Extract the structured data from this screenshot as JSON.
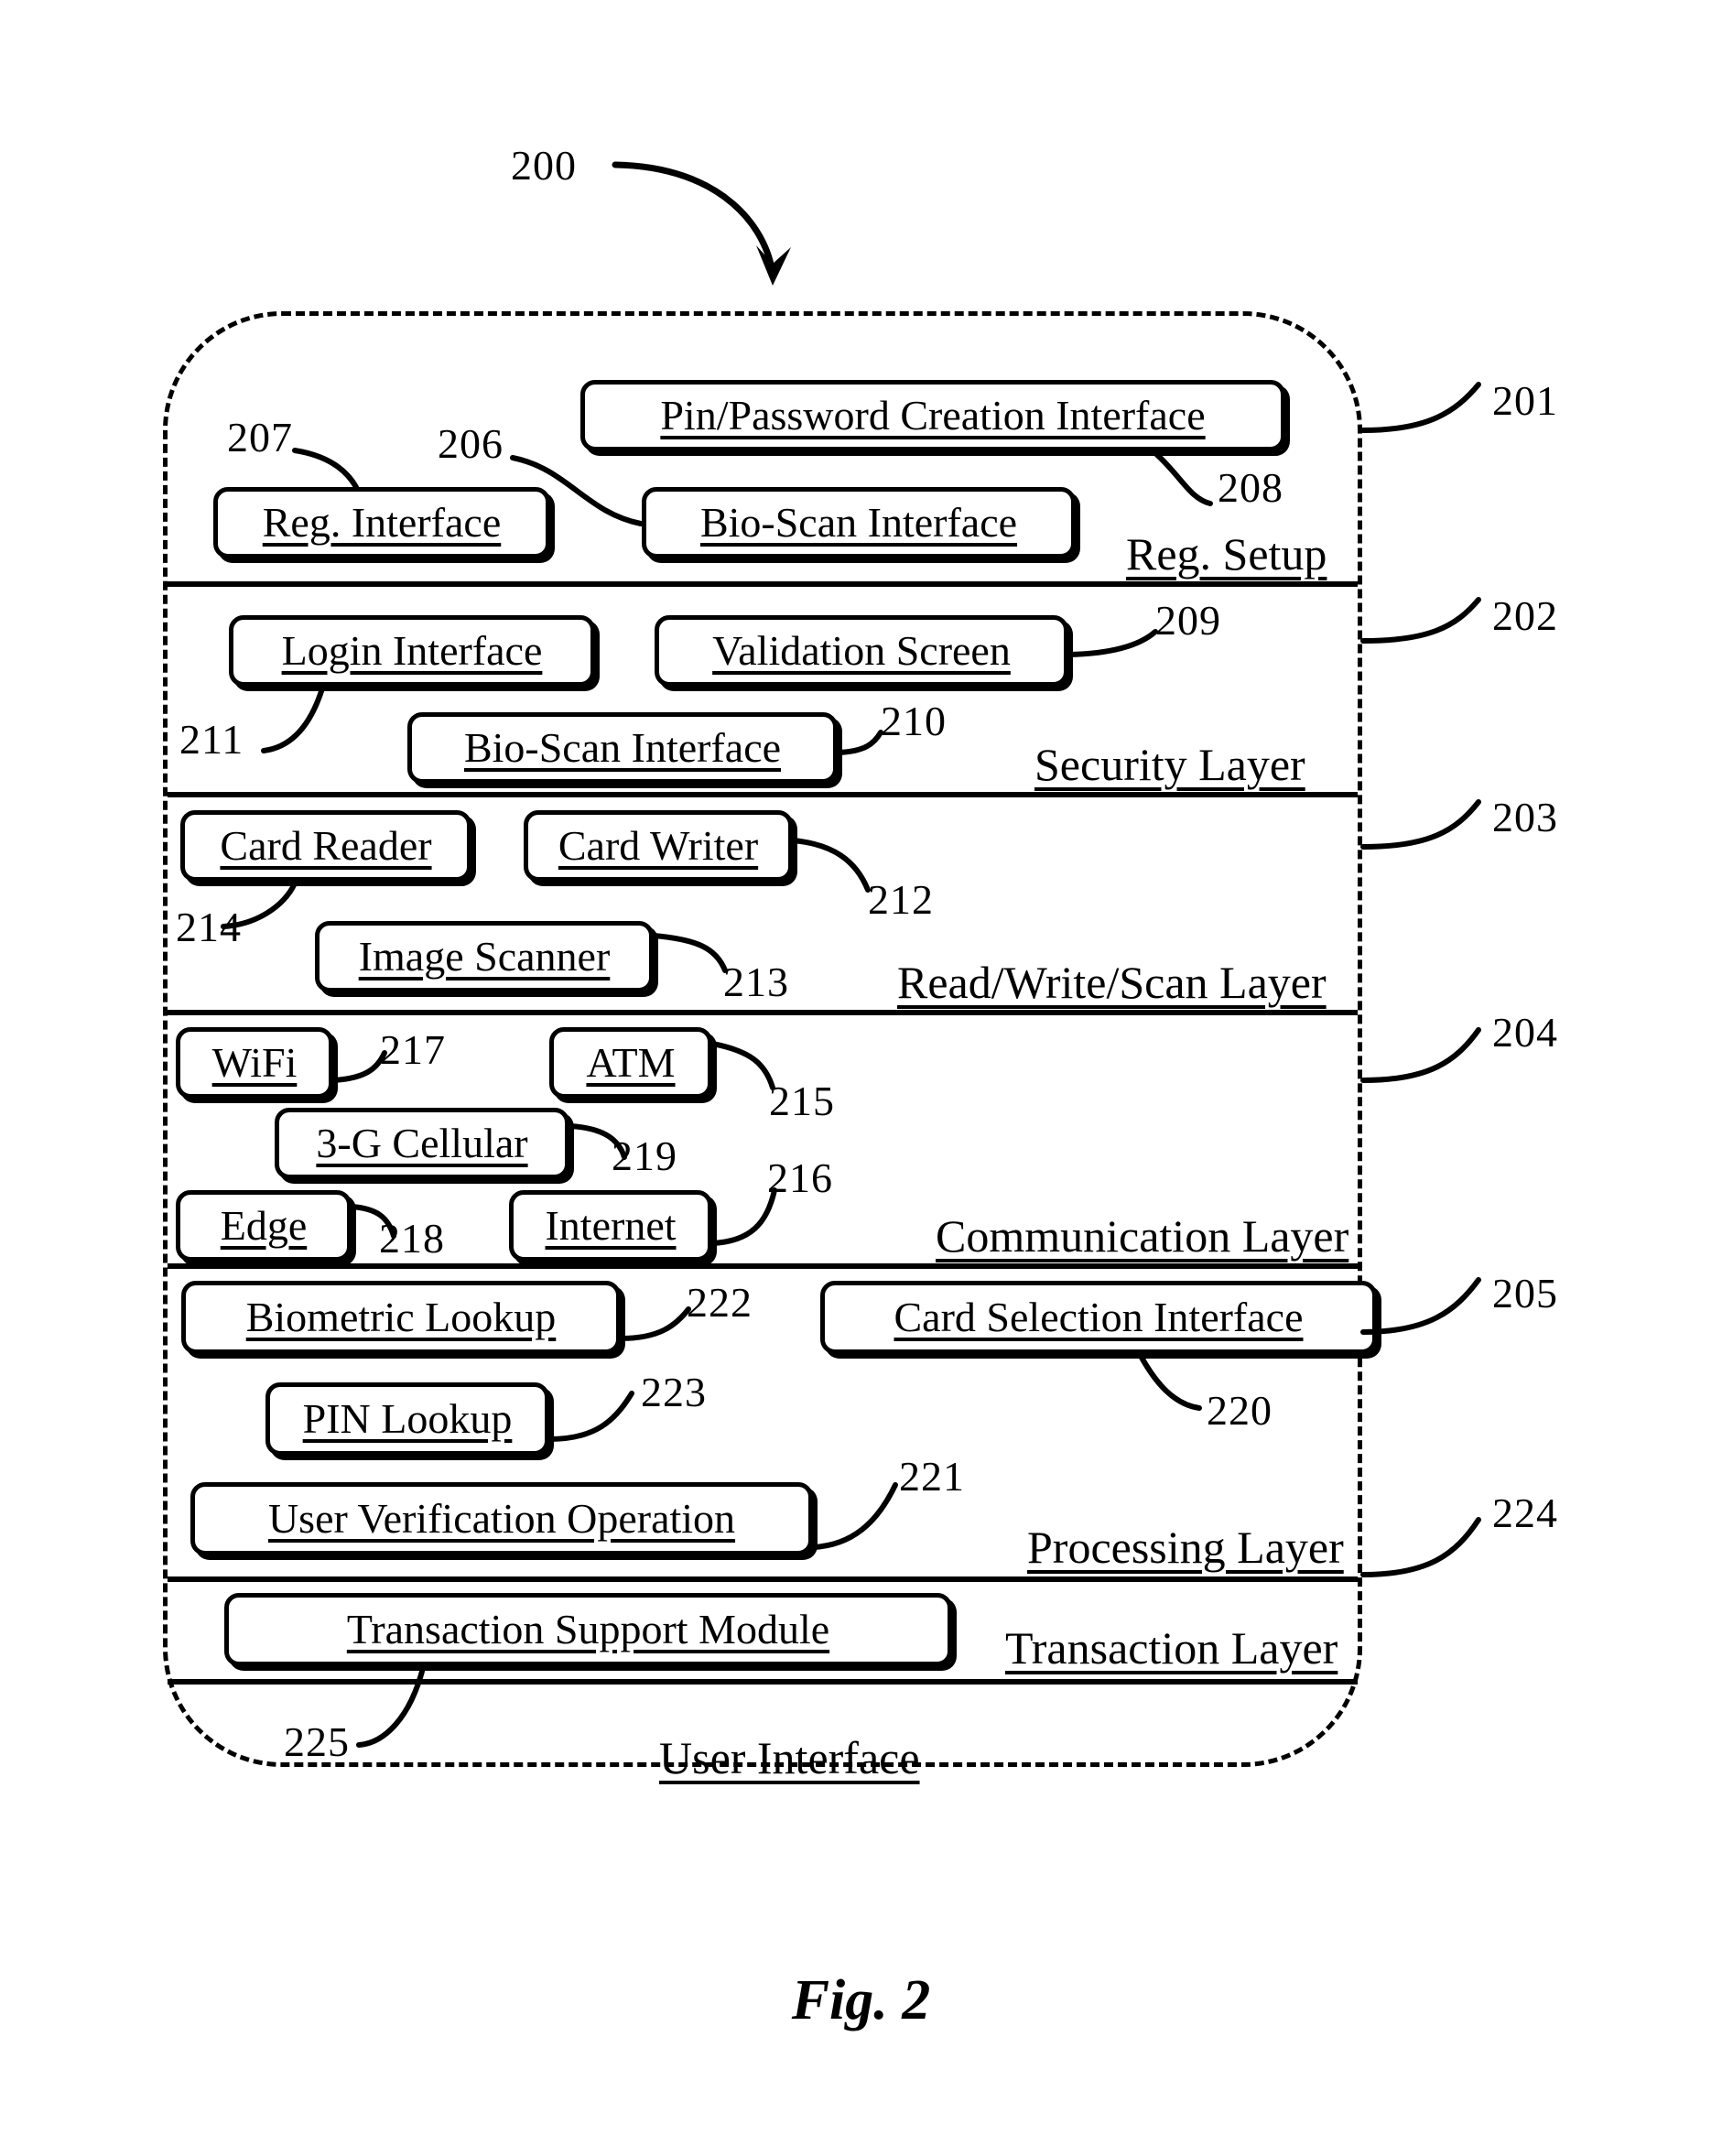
{
  "figure": {
    "caption": "Fig. 2",
    "system_ref": "200"
  },
  "layers": [
    {
      "ref": "201",
      "name": "Reg. Setup",
      "modules": [
        {
          "ref": "208",
          "label": "Pin/Password Creation Interface"
        },
        {
          "ref": "207",
          "label": "Reg. Interface"
        },
        {
          "ref": "206",
          "label": "Bio-Scan Interface"
        }
      ]
    },
    {
      "ref": "202",
      "name": "Security Layer",
      "modules": [
        {
          "ref": "211",
          "label": "Login Interface"
        },
        {
          "ref": "209",
          "label": "Validation Screen"
        },
        {
          "ref": "210",
          "label": "Bio-Scan Interface"
        }
      ]
    },
    {
      "ref": "203",
      "name": "Read/Write/Scan Layer",
      "modules": [
        {
          "ref": "214",
          "label": "Card Reader"
        },
        {
          "ref": "212",
          "label": "Card Writer"
        },
        {
          "ref": "213",
          "label": "Image Scanner"
        }
      ]
    },
    {
      "ref": "204",
      "name": "Communication Layer",
      "modules": [
        {
          "ref": "217",
          "label": "WiFi"
        },
        {
          "ref": "215",
          "label": "ATM"
        },
        {
          "ref": "219",
          "label": "3-G Cellular"
        },
        {
          "ref": "218",
          "label": "Edge"
        },
        {
          "ref": "216",
          "label": "Internet"
        }
      ]
    },
    {
      "ref": "205",
      "name": "Processing Layer",
      "modules": [
        {
          "ref": "222",
          "label": "Biometric Lookup"
        },
        {
          "ref": "220",
          "label": "Card Selection Interface"
        },
        {
          "ref": "223",
          "label": "PIN Lookup"
        },
        {
          "ref": "221",
          "label": "User Verification Operation"
        }
      ]
    },
    {
      "ref": "224",
      "name": "Transaction Layer",
      "modules": [
        {
          "ref": "225",
          "label": "Transaction Support Module"
        }
      ]
    },
    {
      "ref": "",
      "name": "User Interface",
      "modules": []
    }
  ]
}
